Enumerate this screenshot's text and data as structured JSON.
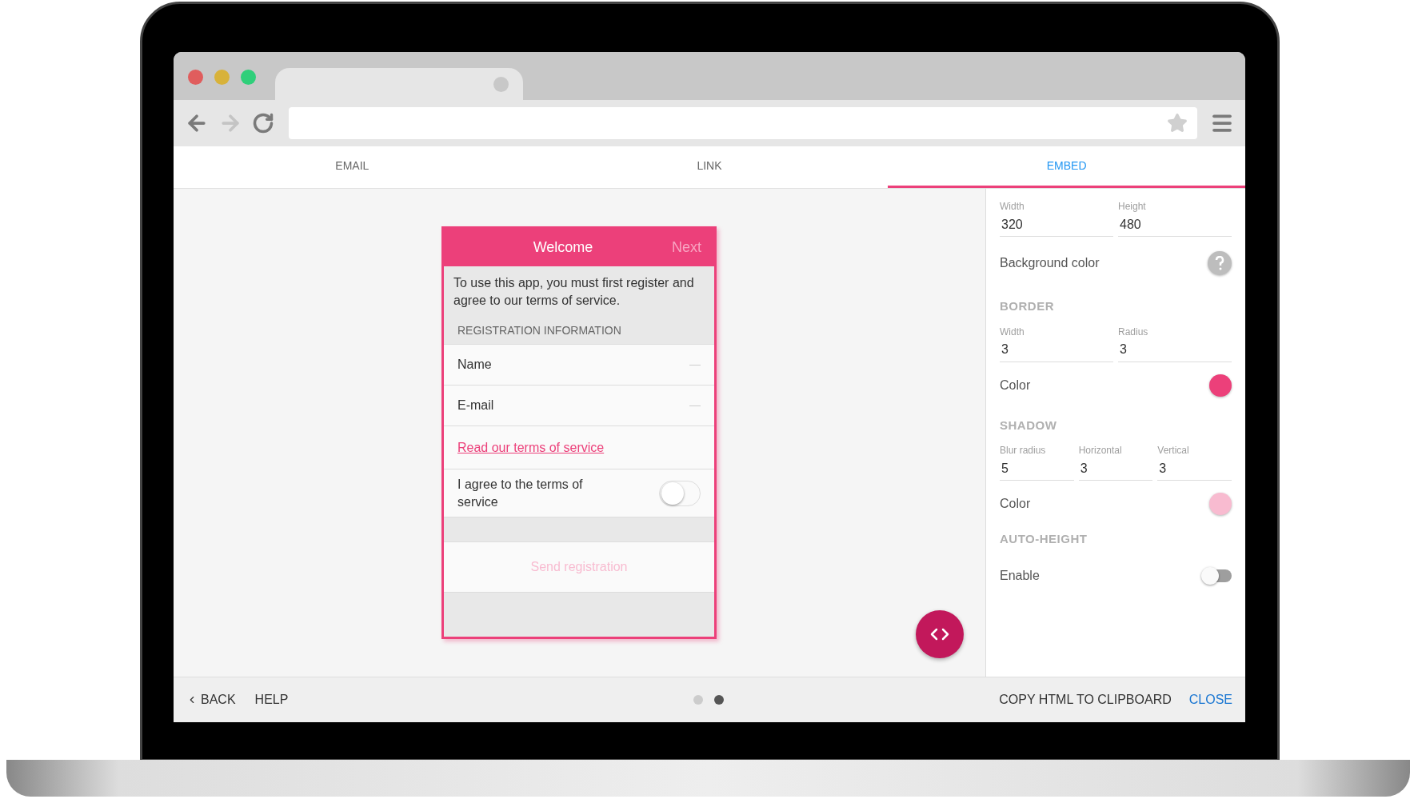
{
  "tabs": [
    {
      "label": "EMAIL",
      "selected": false
    },
    {
      "label": "LINK",
      "selected": false
    },
    {
      "label": "EMBED",
      "selected": true
    }
  ],
  "preview": {
    "title": "Welcome",
    "next": "Next",
    "intro": "To use this app, you must first register and agree to our terms of service.",
    "section": "REGISTRATION INFORMATION",
    "fields": [
      {
        "label": "Name"
      },
      {
        "label": "E-mail"
      }
    ],
    "link": "Read our terms of service",
    "agree": {
      "label": "I agree to the terms of service",
      "on": false
    },
    "submit": "Send registration"
  },
  "panel": {
    "size_fields": [
      {
        "label": "Width",
        "value": "320"
      },
      {
        "label": "Height",
        "value": "480"
      }
    ],
    "background": {
      "label": "Background color"
    },
    "border": {
      "heading": "BORDER",
      "fields": [
        {
          "label": "Width",
          "value": "3"
        },
        {
          "label": "Radius",
          "value": "3"
        }
      ],
      "color": {
        "label": "Color",
        "color": "#ec407a"
      }
    },
    "shadow": {
      "heading": "SHADOW",
      "fields": [
        {
          "label": "Blur radius",
          "value": "5"
        },
        {
          "label": "Horizontal",
          "value": "3"
        },
        {
          "label": "Vertical",
          "value": "3"
        }
      ],
      "color": {
        "label": "Color",
        "color": "#f8bbd0"
      }
    },
    "auto_height": {
      "heading": "AUTO-HEIGHT",
      "enable": {
        "label": "Enable",
        "on": false
      }
    }
  },
  "footer": {
    "back": "BACK",
    "help": "HELP",
    "pages": [
      {
        "selected": false
      },
      {
        "selected": true
      }
    ],
    "copy": "COPY HTML TO CLIPBOARD",
    "close": "CLOSE"
  }
}
